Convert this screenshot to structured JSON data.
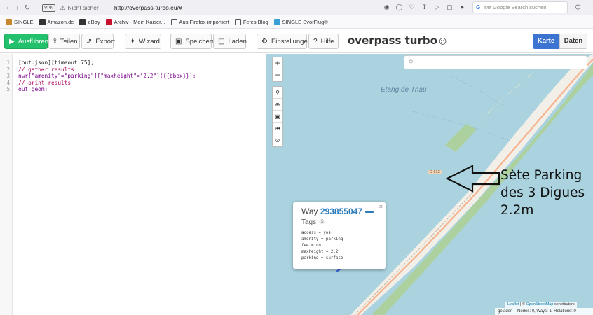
{
  "browser": {
    "vpn": "VPN",
    "security": "Nicht sicher",
    "url": "http://overpass-turbo.eu/#",
    "search_placeholder": "Mit Google Search suchen"
  },
  "bookmarks": [
    {
      "label": "SINGLE",
      "color": "#c8872e"
    },
    {
      "label": "Amazon.de",
      "color": "#333333"
    },
    {
      "label": "eBay",
      "color": "#333333"
    },
    {
      "label": "Archiv - Mein Kaiser...",
      "color": "#c8102e"
    },
    {
      "label": "Aus Firefox importiert",
      "color": "#555555"
    },
    {
      "label": "Fefes Blog",
      "color": "#555555"
    },
    {
      "label": "SINGLE SvorFlug®",
      "color": "#3aa0d8"
    }
  ],
  "toolbar": {
    "run": "Ausführen",
    "share": "Teilen",
    "export": "Export",
    "wizard": "Wizard",
    "save": "Speichern",
    "load": "Laden",
    "settings": "Einstellungen",
    "help": "Hilfe",
    "title": "overpass turbo",
    "tab_map": "Karte",
    "tab_data": "Daten"
  },
  "editor": {
    "lines": [
      {
        "n": "1",
        "text": "[out:json][timeout:75];"
      },
      {
        "n": "2",
        "text": "// gather results"
      },
      {
        "n": "3",
        "text": "nwr[\"amenity\"=\"parking\"][\"maxheight\"=\"2.2\"]({{bbox}});"
      },
      {
        "n": "4",
        "text": "// print results"
      },
      {
        "n": "5",
        "text": "out geom;"
      }
    ]
  },
  "map": {
    "lake_label": "Etang de Thau",
    "road_label": "D 612",
    "annotation": [
      "Sète Parking",
      "des 3 Digues",
      "2.2m"
    ],
    "popup": {
      "prefix": "Way",
      "id": "293855047",
      "tags_label": "Tags",
      "tag_count": "5",
      "tags": [
        "access = yes",
        "amenity = parking",
        "fee = no",
        "maxheight = 2.2",
        "parking = surface"
      ]
    },
    "attribution_leaflet": "Leaflet",
    "attribution_sep": " | © ",
    "attribution_osm": "OpenStreetMap",
    "attribution_suffix": " contributors",
    "status": "geladen – Nodes: 0, Ways: 1, Relations: 0",
    "colors": {
      "water": "#aad3df",
      "land": "#f2efe9",
      "green": "#add19e",
      "accent": "#3d73d1"
    }
  }
}
